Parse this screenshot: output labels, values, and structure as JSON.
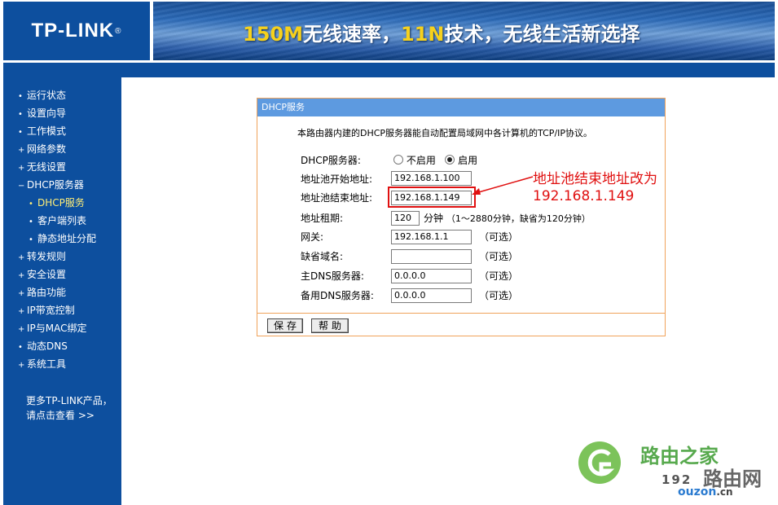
{
  "header": {
    "logo": "TP-LINK",
    "logo_mark": "®",
    "banner": {
      "part1": "150M",
      "part2": "无线速率，",
      "part3": "11N",
      "part4": "技术，无线生活新选择"
    }
  },
  "sidebar": {
    "items": [
      {
        "marker": "•",
        "label": "运行状态"
      },
      {
        "marker": "•",
        "label": "设置向导"
      },
      {
        "marker": "•",
        "label": "工作模式"
      },
      {
        "marker": "+",
        "label": "网络参数"
      },
      {
        "marker": "+",
        "label": "无线设置"
      },
      {
        "marker": "−",
        "label": "DHCP服务器"
      },
      {
        "marker": "•",
        "label": "DHCP服务"
      },
      {
        "marker": "•",
        "label": "客户端列表"
      },
      {
        "marker": "•",
        "label": "静态地址分配"
      },
      {
        "marker": "+",
        "label": "转发规则"
      },
      {
        "marker": "+",
        "label": "安全设置"
      },
      {
        "marker": "+",
        "label": "路由功能"
      },
      {
        "marker": "+",
        "label": "IP带宽控制"
      },
      {
        "marker": "+",
        "label": "IP与MAC绑定"
      },
      {
        "marker": "•",
        "label": "动态DNS"
      },
      {
        "marker": "+",
        "label": "系统工具"
      }
    ],
    "more_line1": "更多TP-LINK产品，",
    "more_line2": "请点击查看 >>"
  },
  "panel": {
    "title": "DHCP服务",
    "description": "本路由器内建的DHCP服务器能自动配置局域网中各计算机的TCP/IP协议。",
    "dhcp_server": {
      "label": "DHCP服务器:",
      "option_off": "不启用",
      "option_on": "启用",
      "selected": "启用"
    },
    "pool_start": {
      "label": "地址池开始地址:",
      "value": "192.168.1.100"
    },
    "pool_end": {
      "label": "地址池结束地址:",
      "value": "192.168.1.149"
    },
    "lease": {
      "label": "地址租期:",
      "value": "120",
      "unit": "分钟",
      "hint": "（1～2880分钟，缺省为120分钟）"
    },
    "gateway": {
      "label": "网关:",
      "value": "192.168.1.1",
      "hint": "（可选）"
    },
    "domain": {
      "label": "缺省域名:",
      "value": "",
      "hint": "（可选）"
    },
    "dns1": {
      "label": "主DNS服务器:",
      "value": "0.0.0.0",
      "hint": "（可选）"
    },
    "dns2": {
      "label": "备用DNS服务器:",
      "value": "0.0.0.0",
      "hint": "（可选）"
    },
    "save_button": "保存",
    "help_button": "帮助"
  },
  "annotation": {
    "line1": "地址池结束地址改为",
    "line2": "192.168.1.149",
    "color": "#e01010"
  },
  "watermark": {
    "site_cn": "路由之家",
    "number": "192",
    "site2": "路由网",
    "domain": "ouzon",
    "tld": ".cn"
  },
  "colors": {
    "brand_blue": "#0d4f9e",
    "panel_title": "#5d9ae0",
    "panel_border": "#f0a35a",
    "banner_accent": "#f6d11d"
  }
}
